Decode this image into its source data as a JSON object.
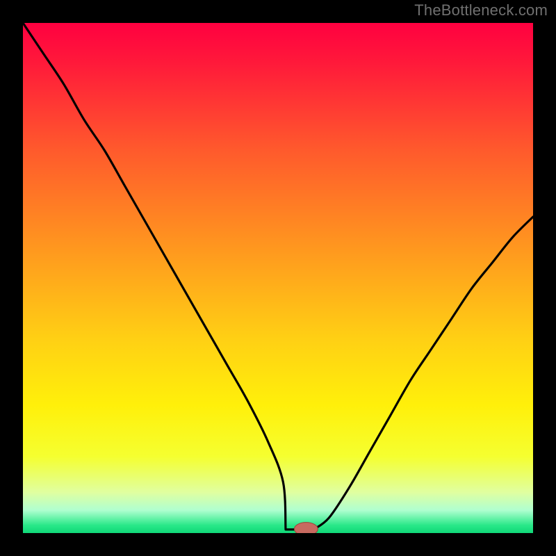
{
  "watermark": "TheBottleneck.com",
  "colors": {
    "frame": "#000000",
    "gradient_stops": [
      {
        "offset": 0.0,
        "color": "#ff0040"
      },
      {
        "offset": 0.08,
        "color": "#ff1a3a"
      },
      {
        "offset": 0.25,
        "color": "#ff5a2c"
      },
      {
        "offset": 0.45,
        "color": "#ff9a1e"
      },
      {
        "offset": 0.62,
        "color": "#ffd014"
      },
      {
        "offset": 0.75,
        "color": "#fff00a"
      },
      {
        "offset": 0.85,
        "color": "#f5ff30"
      },
      {
        "offset": 0.92,
        "color": "#e0ffa0"
      },
      {
        "offset": 0.955,
        "color": "#b0ffd0"
      },
      {
        "offset": 0.985,
        "color": "#28e888"
      },
      {
        "offset": 1.0,
        "color": "#10d878"
      }
    ],
    "curve": "#000000",
    "marker_fill": "#c86a60",
    "marker_stroke": "#a04038"
  },
  "chart_data": {
    "type": "line",
    "title": "",
    "xlabel": "",
    "ylabel": "",
    "xlim": [
      0,
      100
    ],
    "ylim": [
      0,
      100
    ],
    "grid": false,
    "legend": false,
    "series": [
      {
        "name": "bottleneck-curve",
        "x": [
          0,
          4,
          8,
          12,
          16,
          20,
          24,
          28,
          32,
          36,
          40,
          44,
          48,
          51,
          53,
          55,
          57,
          60,
          64,
          68,
          72,
          76,
          80,
          84,
          88,
          92,
          96,
          100
        ],
        "y": [
          100,
          94,
          88,
          81,
          75,
          68,
          61,
          54,
          47,
          40,
          33,
          26,
          18,
          10,
          4,
          0.7,
          0.7,
          3,
          9,
          16,
          23,
          30,
          36,
          42,
          48,
          53,
          58,
          62
        ]
      }
    ],
    "marker": {
      "x": 55.5,
      "y": 0.8,
      "rx": 2.3,
      "ry": 1.3
    },
    "flat_segment": {
      "x0": 51.5,
      "x1": 57.0,
      "y": 0.7
    }
  }
}
